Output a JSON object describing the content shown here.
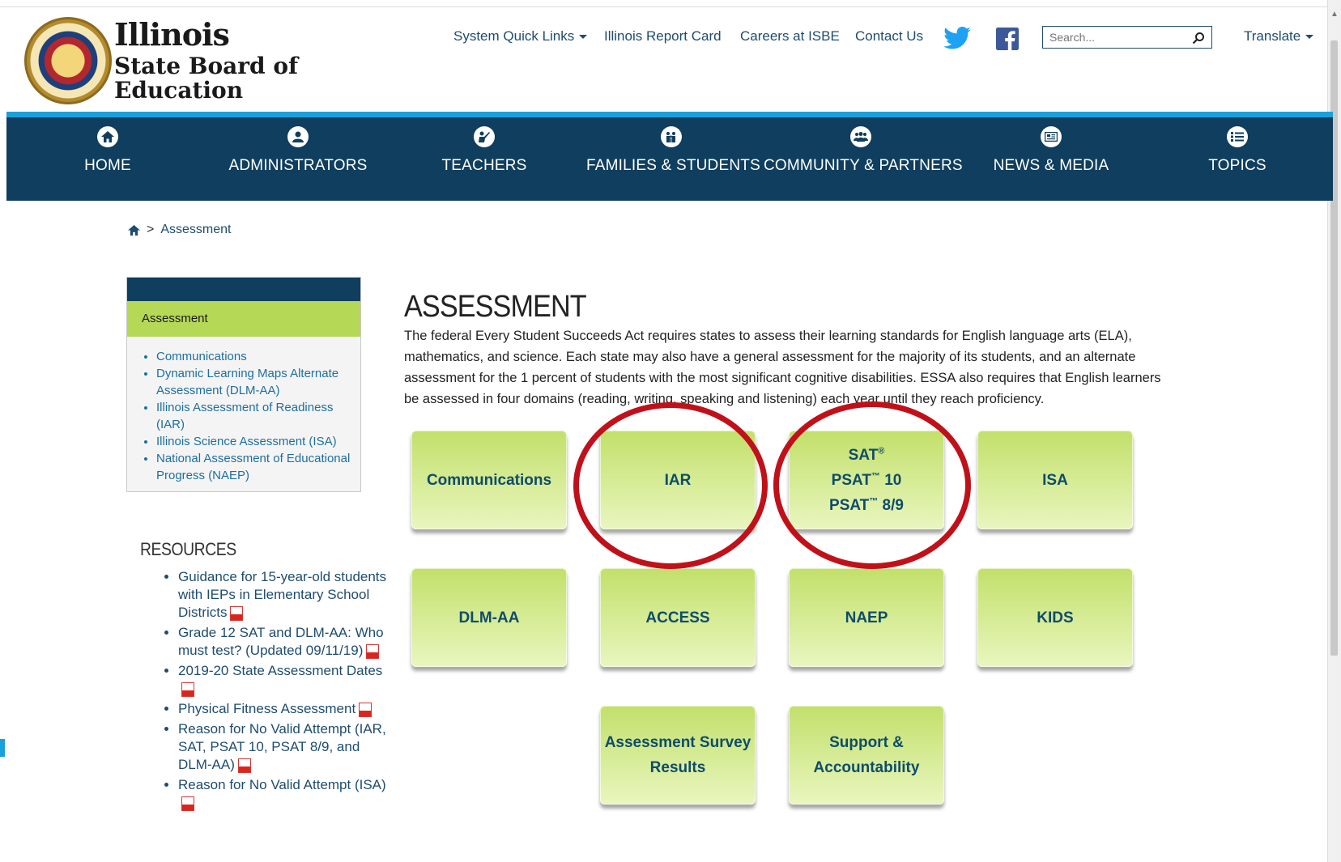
{
  "logo": {
    "line1": "Illinois",
    "line2": "State Board of",
    "line3": "Education"
  },
  "utility_links": {
    "quick_links": "System Quick Links",
    "report_card": "Illinois Report Card",
    "careers": "Careers at ISBE",
    "contact": "Contact Us",
    "search_placeholder": "Search...",
    "translate": "Translate"
  },
  "nav": {
    "home": "HOME",
    "administrators": "ADMINISTRATORS",
    "teachers": "TEACHERS",
    "families": "FAMILIES & STUDENTS",
    "community": "COMMUNITY & PARTNERS",
    "news": "NEWS & MEDIA",
    "topics": "TOPICS"
  },
  "breadcrumb": {
    "separator": ">",
    "current": "Assessment"
  },
  "sidebar": {
    "header": "Assessment",
    "items": [
      "Communications",
      "Dynamic Learning Maps Alternate Assessment (DLM-AA)",
      "Illinois Assessment of Readiness (IAR)",
      "Illinois Science Assessment (ISA)",
      "National Assessment of Educational Progress (NAEP)"
    ]
  },
  "resources": {
    "title": "RESOURCES",
    "items": [
      "Guidance for 15-year-old students with IEPs in Elementary School Districts",
      "Grade 12 SAT and DLM-AA: Who must test? (Updated 09/11/19)",
      "2019-20 State Assessment Dates",
      "Physical Fitness Assessment",
      "Reason for No Valid Attempt (IAR, SAT, PSAT 10, PSAT 8/9, and DLM-AA)",
      "Reason for No Valid Attempt (ISA)"
    ]
  },
  "main": {
    "title": "ASSESSMENT",
    "intro": "The federal Every Student Succeeds Act requires states to assess their learning standards for English language arts (ELA), mathematics, and science. Each state may also have a general assessment for the majority of its students, and an alternate assessment for the 1 percent of students with the most significant cognitive disabilities. ESSA also requires that English learners be assessed in four domains (reading, writing, speaking and listening) each year until they reach proficiency."
  },
  "tiles": {
    "communications": "Communications",
    "iar": "IAR",
    "sat": "SAT",
    "psat10": "PSAT",
    "psat10_num": " 10",
    "psat89": "PSAT",
    "psat89_num": " 8/9",
    "reg": "®",
    "tm": "™",
    "isa": "ISA",
    "dlmaa": "DLM-AA",
    "access": "ACCESS",
    "naep": "NAEP",
    "kids": "KIDS",
    "survey_line1": "Assessment Survey",
    "survey_line2": "Results",
    "support_line1": "Support &",
    "support_line2": "Accountability"
  },
  "colors": {
    "nav_bg": "#0f3e5e",
    "accent_blue": "#1aa0db",
    "tile_green": "#c2e06a",
    "sidebar_green": "#b6d857",
    "annotation_red": "#c0111a"
  },
  "icons": {
    "home": "home-icon",
    "administrators": "user-icon",
    "teachers": "teacher-icon",
    "families": "family-icon",
    "community": "group-icon",
    "news": "newspaper-icon",
    "topics": "list-icon",
    "twitter": "twitter-icon",
    "facebook": "facebook-icon",
    "search": "search-icon",
    "pdf": "pdf-icon"
  }
}
